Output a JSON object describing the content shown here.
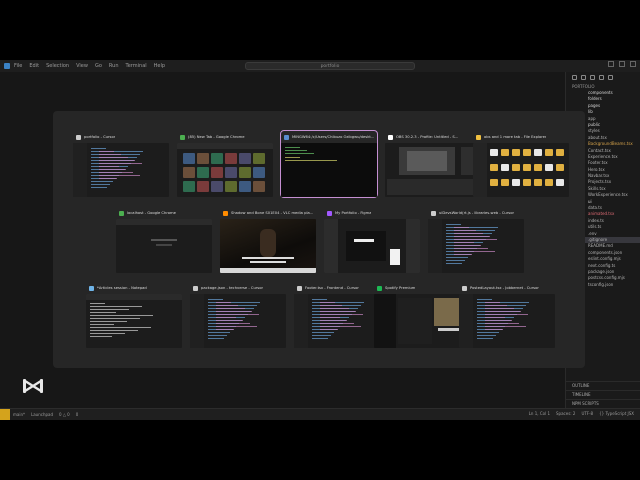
{
  "menubar": {
    "items": [
      "File",
      "Edit",
      "Selection",
      "View",
      "Go",
      "Run",
      "Terminal",
      "Help"
    ],
    "command_center": "portfolio"
  },
  "explorer": {
    "title": "PORTFOLIO",
    "files": [
      {
        "label": "components",
        "kind": "dir"
      },
      {
        "label": "folders",
        "kind": "dir"
      },
      {
        "label": "pages",
        "kind": "dir"
      },
      {
        "label": "lib",
        "kind": "dir"
      },
      {
        "label": "app",
        "kind": "file"
      },
      {
        "label": "public",
        "kind": "dir"
      },
      {
        "label": "styles",
        "kind": "file"
      },
      {
        "label": "about.tsx",
        "kind": "file"
      },
      {
        "label": "BackgroundBeams.tsx",
        "kind": "mod"
      },
      {
        "label": "Contact.tsx",
        "kind": "file"
      },
      {
        "label": "Experience.tsx",
        "kind": "file"
      },
      {
        "label": "Footer.tsx",
        "kind": "file"
      },
      {
        "label": "Hero.tsx",
        "kind": "file"
      },
      {
        "label": "Navbar.tsx",
        "kind": "file"
      },
      {
        "label": "Projects.tsx",
        "kind": "file"
      },
      {
        "label": "Skills.tsx",
        "kind": "file"
      },
      {
        "label": "WorkExperience.tsx",
        "kind": "file"
      },
      {
        "label": "ui",
        "kind": "dir"
      },
      {
        "label": "data.ts",
        "kind": "file"
      },
      {
        "label": "animated.tsx",
        "kind": "err"
      },
      {
        "label": "index.ts",
        "kind": "file"
      },
      {
        "label": "utils.ts",
        "kind": "file"
      },
      {
        "label": ".env",
        "kind": "file"
      },
      {
        "label": ".gitignore",
        "kind": "sel"
      },
      {
        "label": "README.md",
        "kind": "file"
      },
      {
        "label": "components.json",
        "kind": "file"
      },
      {
        "label": "eslint.config.mjs",
        "kind": "file"
      },
      {
        "label": "next.config.ts",
        "kind": "file"
      },
      {
        "label": "package.json",
        "kind": "file"
      },
      {
        "label": "postcss.config.mjs",
        "kind": "file"
      },
      {
        "label": "tsconfig.json",
        "kind": "file"
      }
    ],
    "sections": [
      "OUTLINE",
      "TIMELINE",
      "NPM SCRIPTS"
    ]
  },
  "statusbar": {
    "left": [
      "main*",
      "Launchpad",
      "0 △ 0",
      "0"
    ],
    "right": [
      "Ln 1, Col 1",
      "Spaces: 2",
      "UTF-8",
      "{} TypeScript JSX"
    ]
  },
  "windows": [
    {
      "label": "portfolio - Cursor",
      "icon_color": "#cccccc",
      "kind": "cursor",
      "active": false
    },
    {
      "label": "(85) New Tab - Google Chrome",
      "icon_color": "#4caf50",
      "kind": "chrome",
      "active": false
    },
    {
      "label": "MINGW64:/c/Users/Chibuzo Ozibgwu/deskt...",
      "icon_color": "#5a8dd0",
      "kind": "terminal",
      "active": true
    },
    {
      "label": "OBS 30.2.3 - Profile: Untitled - S...",
      "icon_color": "#ffffff",
      "kind": "obs",
      "active": false
    },
    {
      "label": "obs and 1 more tab - File Explorer",
      "icon_color": "#f0c040",
      "kind": "explorer",
      "active": false
    },
    {
      "label": "localhost - Google Chrome",
      "icon_color": "#4caf50",
      "kind": "localhost",
      "active": false
    },
    {
      "label": "Shadow and Bone S01E04 - VLC media pla...",
      "icon_color": "#ff8c00",
      "kind": "vlc",
      "active": false
    },
    {
      "label": "My Portfolio - Figma",
      "icon_color": "#a259ff",
      "kind": "figma",
      "active": false
    },
    {
      "label": "uiDevsWorld(rt.js - libraries-web - Cursor",
      "icon_color": "#cccccc",
      "kind": "cursor",
      "active": false
    },
    {
      "label": "*Articles session - Notepad",
      "icon_color": "#6fb4e8",
      "kind": "notepad",
      "active": false
    },
    {
      "label": "package.json - techverse - Cursor",
      "icon_color": "#cccccc",
      "kind": "cursor",
      "active": false
    },
    {
      "label": "Footer.tsx - Frontend - Cursor",
      "icon_color": "#cccccc",
      "kind": "cursor",
      "active": false
    },
    {
      "label": "Spotify Premium",
      "icon_color": "#1db954",
      "kind": "spotify",
      "active": false
    },
    {
      "label": "PostedLayout.tsx - Jobbernet - Cursor",
      "icon_color": "#cccccc",
      "kind": "cursor",
      "active": false
    }
  ],
  "colors": {
    "overlay": "#262626",
    "active_outline": "#c58fd2",
    "explorer_modified": "#d4a24a",
    "explorer_error": "#e06c75"
  }
}
